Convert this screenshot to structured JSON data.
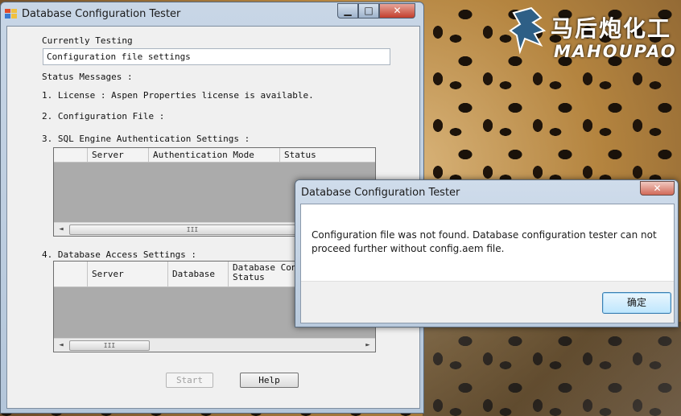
{
  "desktop": {
    "watermark_cn": "马后炮化工",
    "watermark_en": "MAHOUPAO"
  },
  "main_window": {
    "title": "Database Configuration Tester",
    "controls": {
      "minimize": "▁",
      "maximize": "□",
      "close": "✕"
    },
    "currently_testing_label": "Currently Testing",
    "currently_testing_value": "Configuration file settings",
    "status_messages_label": "Status Messages :",
    "item1": "1. License : Aspen Properties license is available.",
    "item2": "2. Configuration File :",
    "item3": "3. SQL Engine Authentication Settings :",
    "sql_grid": {
      "columns": [
        "Server",
        "Authentication Mode",
        "Status"
      ],
      "scroll_left": "◄",
      "scroll_thumb": "III",
      "scroll_right": "►"
    },
    "item4": "4. Database Access Settings :",
    "db_grid": {
      "columns": [
        "Server",
        "Database",
        "Database Conn",
        "Status"
      ],
      "scroll_left": "◄",
      "scroll_thumb": "III",
      "scroll_right": "►"
    },
    "start_button": "Start",
    "help_button": "Help"
  },
  "dialog": {
    "title": "Database Configuration Tester",
    "close": "✕",
    "message": "Configuration file was not found. Database configuration tester can not proceed further without config.aem file.",
    "ok_button": "确定"
  }
}
